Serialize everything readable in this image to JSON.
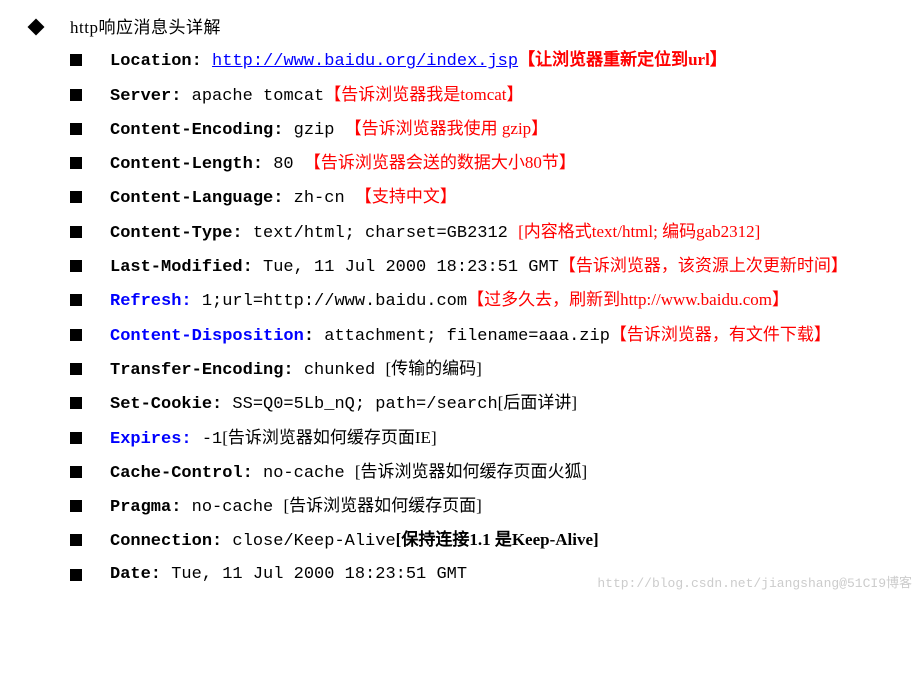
{
  "title": "http响应消息头详解",
  "items": [
    {
      "header": "Location:",
      "headerClass": "bold",
      "link": "http://www.baidu.org/index.jsp",
      "note": "【让浏览器重新定位到url】",
      "noteClass": "red bold"
    },
    {
      "header": "Server:",
      "headerClass": "bold",
      "value": "apache tomcat",
      "note": "【告诉浏览器我是tomcat】",
      "noteClass": "red"
    },
    {
      "header": "Content-Encoding:",
      "headerClass": "bold",
      "value": " gzip ",
      "note": "【告诉浏览器我使用 gzip】",
      "noteClass": "red"
    },
    {
      "header": "Content-Length:",
      "headerClass": "bold",
      "value": " 80 ",
      "note": "【告诉浏览器会送的数据大小80节】",
      "noteClass": "red"
    },
    {
      "header": "Content-Language:",
      "headerClass": "bold",
      "value": " zh-cn ",
      "note": "【支持中文】",
      "noteClass": "red"
    },
    {
      "header": "Content-Type:",
      "headerClass": "bold",
      "value": " text/html; charset=GB2312 ",
      "note": "[内容格式text/html; 编码gab2312]",
      "noteClass": "red"
    },
    {
      "header": "Last-Modified:",
      "headerClass": "bold",
      "value": " Tue, 11 Jul 2000 18:23:51 GMT",
      "note": "【告诉浏览器，该资源上次更新时间】",
      "noteClass": "red"
    },
    {
      "header": "Refresh:",
      "headerClass": "bold blue",
      "value": " 1;url=http://www.baidu.com",
      "note": "【过多久去，刷新到http://www.baidu.com】",
      "noteClass": "red"
    },
    {
      "header": "Content-Disposition",
      "headerClass": "bold blue",
      "colon": ":",
      "value": " attachment; filename=aaa.zip",
      "note": "【告诉浏览器，有文件下载】",
      "noteClass": "red"
    },
    {
      "header": "Transfer-Encoding:",
      "headerClass": "bold",
      "value": " chunked  ",
      "note": "[传输的编码]"
    },
    {
      "header": "Set-Cookie:",
      "headerClass": "bold",
      "value": "SS=Q0=5Lb_nQ; path=/search",
      "note": "[后面详讲]"
    },
    {
      "header": "Expires:",
      "headerClass": "bold blue",
      "value": " -1",
      "note": "[告诉浏览器如何缓存页面IE]"
    },
    {
      "header": "Cache-Control:",
      "headerClass": "bold",
      "value": " no-cache  ",
      "note": "[告诉浏览器如何缓存页面火狐]"
    },
    {
      "header": "Pragma:",
      "headerClass": "bold",
      "value": " no-cache   ",
      "note": "[告诉浏览器如何缓存页面]"
    },
    {
      "header": "Connection:",
      "headerClass": "bold",
      "value": " close/Keep-Alive",
      "note": "[保持连接1.1 是Keep-Alive]",
      "noteClass": "bold"
    },
    {
      "header": "Date:",
      "headerClass": "bold",
      "value": " Tue, 11 Jul 2000 18:23:51 GMT"
    }
  ],
  "watermark_top": "http://blog.csdn.net/jiangshang@51CI9博客",
  "watermark_bottom": ""
}
